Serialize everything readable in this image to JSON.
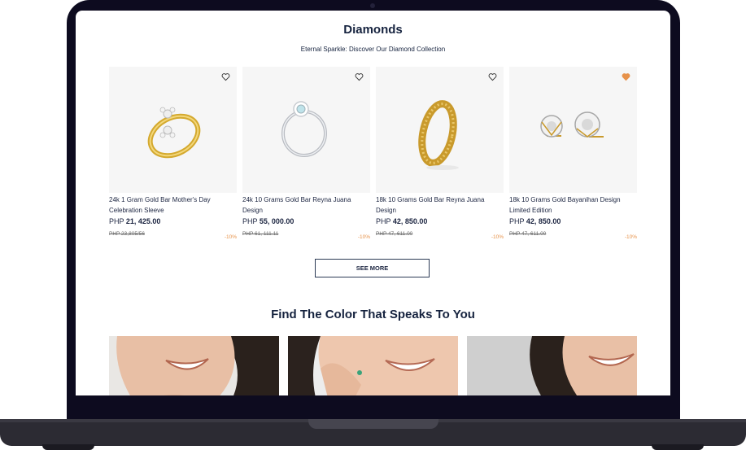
{
  "section": {
    "title": "Diamonds",
    "subtitle": "Eternal Sparkle: Discover Our Diamond Collection"
  },
  "products": [
    {
      "name": "24k 1 Gram Gold Bar Mother's Day Celebration Sleeve",
      "currency": "PHP",
      "price": "21, 425.00",
      "old_price": "PHP 23,805/56",
      "discount": "-10%",
      "favorited": false
    },
    {
      "name": "24k 10 Grams Gold Bar Reyna Juana Design",
      "currency": "PHP",
      "price": "55, 000.00",
      "old_price": "PHP 61, 111.11",
      "discount": "-10%",
      "favorited": false
    },
    {
      "name": "18k 10 Grams Gold Bar Reyna Juana Design",
      "currency": "PHP",
      "price": "42, 850.00",
      "old_price": "PHP 47, 611.00",
      "discount": "-10%",
      "favorited": false
    },
    {
      "name": "18k 10 Grams Gold Bayanihan Design Limited Edition",
      "currency": "PHP",
      "price": "42, 850.00",
      "old_price": "PHP 47, 611.00",
      "discount": "-10%",
      "favorited": true
    }
  ],
  "see_more_label": "SEE MORE",
  "color_section": {
    "title": "Find The Color That Speaks To You"
  },
  "colors": {
    "navy": "#16233f",
    "discount": "#e7924a",
    "heart_active": "#e7924a",
    "card_bg": "#f6f6f6"
  }
}
